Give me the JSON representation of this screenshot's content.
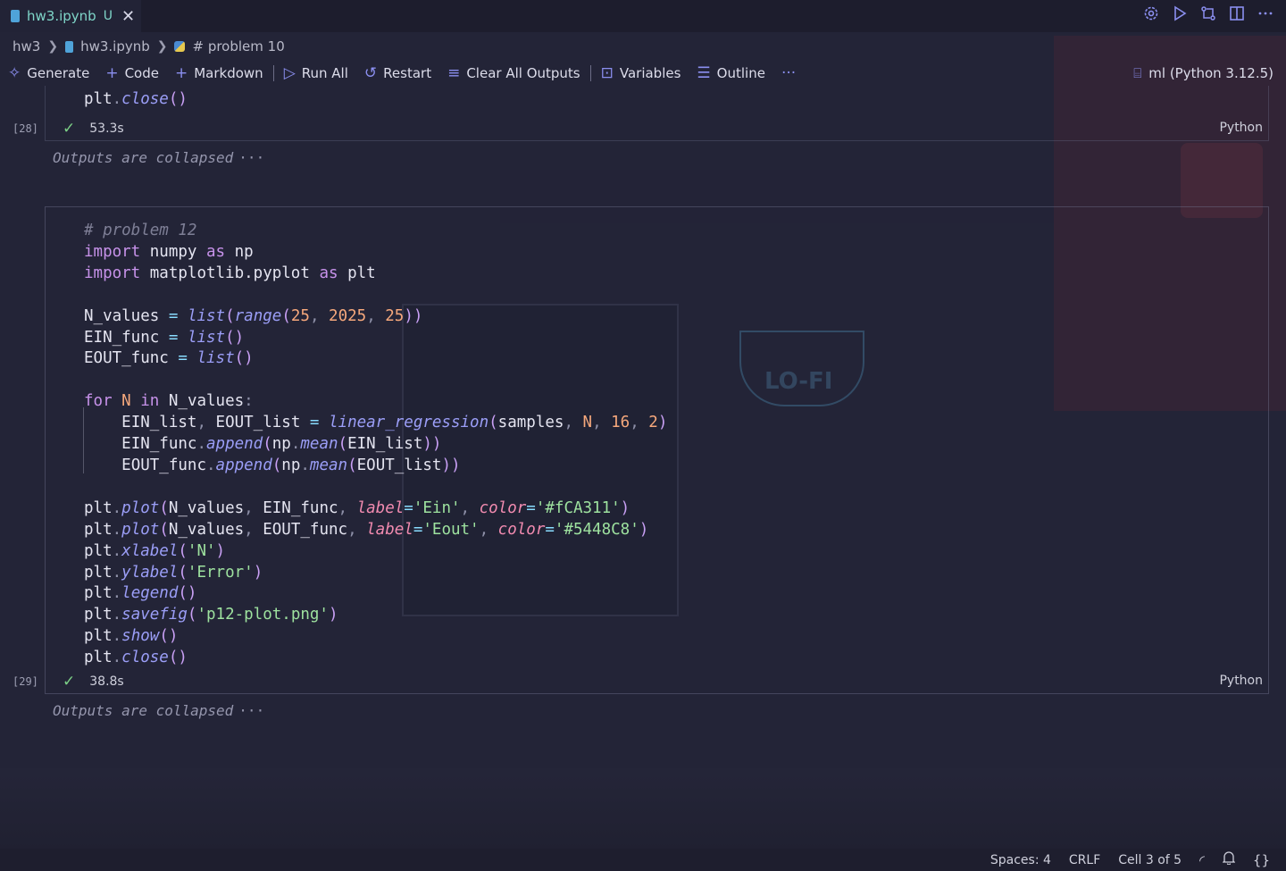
{
  "tab": {
    "filename": "hw3.ipynb",
    "status": "U",
    "close": "✕"
  },
  "breadcrumb": {
    "folder": "hw3",
    "file": "hw3.ipynb",
    "section": "# problem 10",
    "separator": "❯"
  },
  "toolbar": {
    "generate": "Generate",
    "code": "Code",
    "markdown": "Markdown",
    "run_all": "Run All",
    "restart": "Restart",
    "clear_outputs": "Clear All Outputs",
    "variables": "Variables",
    "outline": "Outline",
    "more": "···",
    "kernel": "ml (Python 3.12.5)"
  },
  "cells": [
    {
      "visible_code_tail": "plt.close()",
      "exec_count": "[28]",
      "duration": "53.3s",
      "language": "Python",
      "outputs_text": "Outputs are collapsed",
      "outputs_more": "···"
    },
    {
      "exec_count": "[29]",
      "duration": "38.8s",
      "language": "Python",
      "outputs_text": "Outputs are collapsed",
      "outputs_more": "···",
      "code": {
        "comment": "# problem 12",
        "import1": [
          "import",
          "numpy",
          "as",
          "np"
        ],
        "import2": [
          "import",
          "matplotlib.pyplot",
          "as",
          "plt"
        ],
        "n_values": [
          "N_values",
          "=",
          "list",
          "range",
          "25",
          "2025",
          "25"
        ],
        "ein_func": [
          "EIN_func",
          "=",
          "list"
        ],
        "eout_func": [
          "EOUT_func",
          "=",
          "list"
        ],
        "for": [
          "for",
          "N",
          "in",
          "N_values"
        ],
        "lr": [
          "EIN_list",
          "EOUT_list",
          "=",
          "linear_regression",
          "samples",
          "N",
          "16",
          "2"
        ],
        "append1": [
          "EIN_func",
          "append",
          "np",
          "mean",
          "EIN_list"
        ],
        "append2": [
          "EOUT_func",
          "append",
          "np",
          "mean",
          "EOUT_list"
        ],
        "plot1": [
          "plt",
          "plot",
          "N_values",
          "EIN_func",
          "label",
          "'Ein'",
          "color",
          "'#fCA311'"
        ],
        "plot2": [
          "plt",
          "plot",
          "N_values",
          "EOUT_func",
          "label",
          "'Eout'",
          "color",
          "'#5448C8'"
        ],
        "xlabel": [
          "plt",
          "xlabel",
          "'N'"
        ],
        "ylabel": [
          "plt",
          "ylabel",
          "'Error'"
        ],
        "legend": [
          "plt",
          "legend"
        ],
        "savefig": [
          "plt",
          "savefig",
          "'p12-plot.png'"
        ],
        "show": [
          "plt",
          "show"
        ],
        "close": [
          "plt",
          "close"
        ]
      }
    }
  ],
  "statusbar": {
    "spaces": "Spaces: 4",
    "eol": "CRLF",
    "cell": "Cell 3 of 5"
  },
  "colors": {
    "accent": "#8b8ff0",
    "check": "#7bcf86",
    "tab_text": "#7fd6c9"
  }
}
